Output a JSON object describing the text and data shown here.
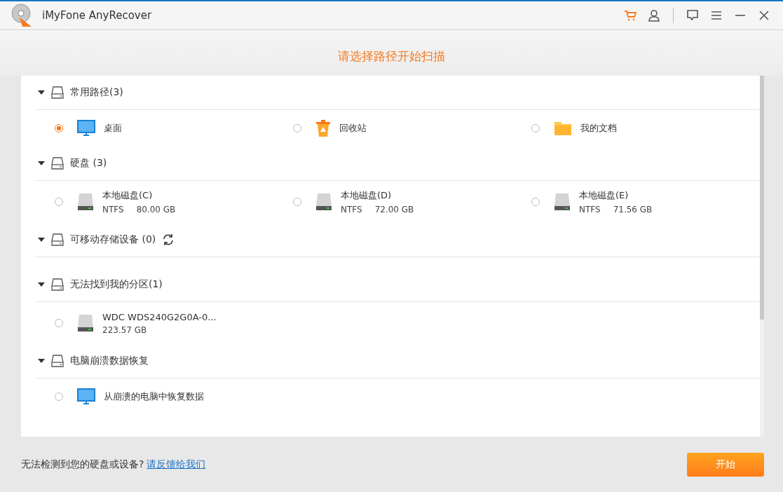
{
  "window": {
    "title": "iMyFone AnyRecover"
  },
  "heading": "请选择路径开始扫描",
  "sections": [
    {
      "title": "常用路径(3)",
      "expanded": true,
      "refresh": false,
      "items": [
        {
          "kind": "desktop",
          "name": "桌面",
          "selected": true
        },
        {
          "kind": "recycle-bin",
          "name": "回收站",
          "selected": false
        },
        {
          "kind": "documents",
          "name": "我的文档",
          "selected": false
        }
      ]
    },
    {
      "title": "硬盘 (3)",
      "expanded": true,
      "refresh": false,
      "items": [
        {
          "kind": "disk",
          "name": "本地磁盘(C)",
          "fs": "NTFS",
          "size": "80.00 GB",
          "selected": false
        },
        {
          "kind": "disk",
          "name": "本地磁盘(D)",
          "fs": "NTFS",
          "size": "72.00 GB",
          "selected": false
        },
        {
          "kind": "disk",
          "name": "本地磁盘(E)",
          "fs": "NTFS",
          "size": "71.56 GB",
          "selected": false
        }
      ]
    },
    {
      "title": "可移动存储设备 (0)",
      "expanded": true,
      "refresh": true
    },
    {
      "title": "无法找到我的分区(1)",
      "expanded": true,
      "refresh": false,
      "items": [
        {
          "kind": "disk",
          "name": "WDC WDS240G2G0A-0...",
          "size": "223.57 GB",
          "selected": false
        }
      ]
    },
    {
      "title": "电脑崩溃数据恢复",
      "expanded": true,
      "refresh": false,
      "items": [
        {
          "kind": "desktop",
          "name": "从崩溃的电脑中恢复数据",
          "selected": false
        }
      ]
    }
  ],
  "footer": {
    "text": "无法检测到您的硬盘或设备?",
    "link": "请反馈给我们",
    "button": "开始"
  }
}
